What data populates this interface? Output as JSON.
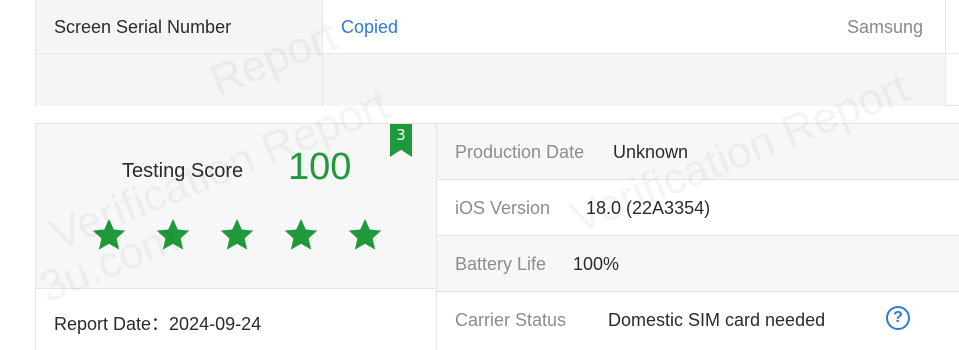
{
  "top_table": {
    "serial_label": "Screen Serial Number",
    "serial_value": "Copied",
    "brand": "Samsung"
  },
  "score": {
    "label": "Testing Score",
    "value": "100",
    "badge": "3",
    "stars_filled": 5,
    "stars_total": 5,
    "star_color": "#1e9a3c"
  },
  "report": {
    "date_text": "Report Date：2024-09-24"
  },
  "info": {
    "production_date": {
      "label": "Production Date",
      "value": "Unknown"
    },
    "ios_version": {
      "label": "iOS Version",
      "value": "18.0 (22A3354)"
    },
    "battery_life": {
      "label": "Battery Life",
      "value": "100%"
    },
    "carrier_status": {
      "label": "Carrier Status",
      "value": "Domestic SIM card needed",
      "help_icon": "question-circle-icon"
    }
  },
  "watermark": {
    "text_1": "Report",
    "text_2": "Verification Report",
    "text_3": "3u.com"
  },
  "colors": {
    "accent_green": "#1e9a3c",
    "link_blue": "#2f7ad6",
    "label_gray": "#8d8d8d"
  }
}
